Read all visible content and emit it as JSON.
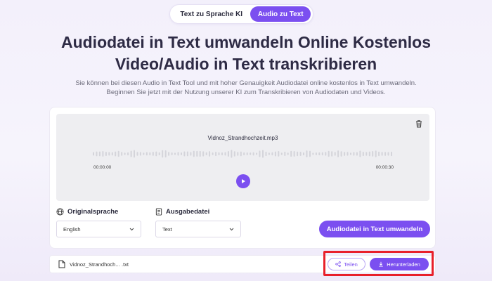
{
  "tabs": {
    "text_to_speech": "Text zu Sprache KI",
    "audio_to_text": "Audio zu Text"
  },
  "header": {
    "title_line1": "Audiodatei in Text umwandeln Online Kostenlos",
    "title_line2": "Video/Audio in Text transkribieren",
    "subtitle_line1": "Sie können bei diesen Audio in Text Tool und mit hoher Genauigkeit Audiodatei online kostenlos in Text umwandeln.",
    "subtitle_line2": "Beginnen Sie jetzt mit der Nutzung unserer KI zum Transkribieren von Audiodaten und Videos."
  },
  "player": {
    "filename": "Vidnoz_Strandhochzeit.mp3",
    "time_start": "00:00:00",
    "time_end": "00:00:30",
    "icons": {
      "delete": "trash-icon",
      "play": "play-icon"
    }
  },
  "settings": {
    "source_language_label": "Originalsprache",
    "source_language_value": "English",
    "output_file_label": "Ausgabedatei",
    "output_file_value": "Text",
    "convert_label": "Audiodatei in Text umwandeln",
    "icons": {
      "language": "globe-icon",
      "output": "document-icon"
    }
  },
  "result": {
    "filename": "Vidnoz_Strandhoch...",
    "extension": ".txt",
    "share_label": "Teilen",
    "download_label": "Herunterladen",
    "icons": {
      "file": "file-icon",
      "share": "share-icon",
      "download": "download-icon"
    }
  },
  "colors": {
    "accent": "#7b4ff0",
    "highlight": "#e8202a"
  }
}
